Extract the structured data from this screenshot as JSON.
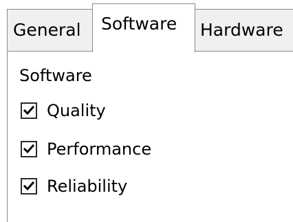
{
  "tabs": {
    "general": "General",
    "software": "Software",
    "hardware": "Hardware",
    "selected": "Software"
  },
  "section": {
    "heading": "Software",
    "options": [
      {
        "label": "Quality",
        "checked": true
      },
      {
        "label": "Performance",
        "checked": true
      },
      {
        "label": "Reliability",
        "checked": true
      }
    ]
  },
  "colors": {
    "border": "#8a8a8a",
    "inactive_tab": "#f0f0f0",
    "active_tab": "#ffffff",
    "checkmark": "#000000"
  }
}
